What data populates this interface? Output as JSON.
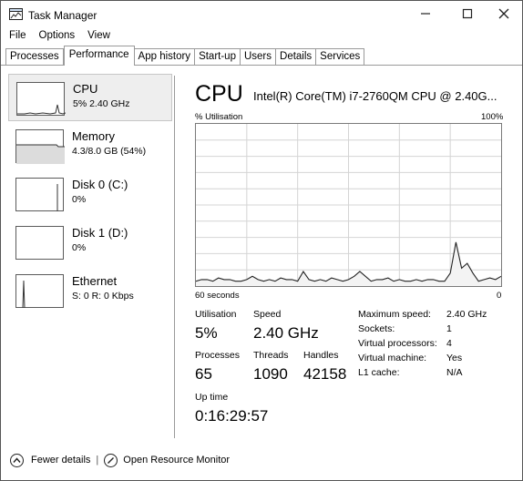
{
  "window": {
    "title": "Task Manager"
  },
  "menu": [
    "File",
    "Options",
    "View"
  ],
  "tabs": [
    "Processes",
    "Performance",
    "App history",
    "Start-up",
    "Users",
    "Details",
    "Services"
  ],
  "active_tab": "Performance",
  "sidebar": {
    "items": [
      {
        "name": "CPU",
        "value": "5% 2.40 GHz"
      },
      {
        "name": "Memory",
        "value": "4.3/8.0 GB (54%)"
      },
      {
        "name": "Disk 0 (C:)",
        "value": "0%"
      },
      {
        "name": "Disk 1 (D:)",
        "value": "0%"
      },
      {
        "name": "Ethernet",
        "value": "S: 0 R: 0 Kbps"
      }
    ]
  },
  "panel": {
    "title": "CPU",
    "model": "Intel(R) Core(TM) i7-2760QM CPU @ 2.40G...",
    "graph_label": "% Utilisation",
    "graph_max": "100%",
    "axis_left": "60 seconds",
    "axis_right": "0",
    "stats": {
      "utilisation_label": "Utilisation",
      "utilisation": "5%",
      "speed_label": "Speed",
      "speed": "2.40 GHz",
      "processes_label": "Processes",
      "processes": "65",
      "threads_label": "Threads",
      "threads": "1090",
      "handles_label": "Handles",
      "handles": "42158",
      "uptime_label": "Up time",
      "uptime": "0:16:29:57"
    },
    "specs": [
      {
        "key": "Maximum speed:",
        "value": "2.40 GHz"
      },
      {
        "key": "Sockets:",
        "value": "1"
      },
      {
        "key": "Virtual processors:",
        "value": "4"
      },
      {
        "key": "Virtual machine:",
        "value": "Yes"
      },
      {
        "key": "L1 cache:",
        "value": "N/A"
      }
    ]
  },
  "footer": {
    "fewer_details": "Fewer details",
    "open_monitor": "Open Resource Monitor"
  },
  "cpu_history_percent": [
    3,
    4,
    4,
    3,
    5,
    4,
    4,
    3,
    3,
    4,
    6,
    4,
    3,
    4,
    3,
    5,
    4,
    4,
    3,
    9,
    4,
    3,
    4,
    3,
    5,
    4,
    3,
    4,
    6,
    9,
    6,
    3,
    4,
    4,
    5,
    3,
    4,
    3,
    3,
    4,
    3,
    4,
    4,
    3,
    3,
    8,
    27,
    11,
    14,
    8,
    3,
    4,
    5,
    4,
    6
  ]
}
